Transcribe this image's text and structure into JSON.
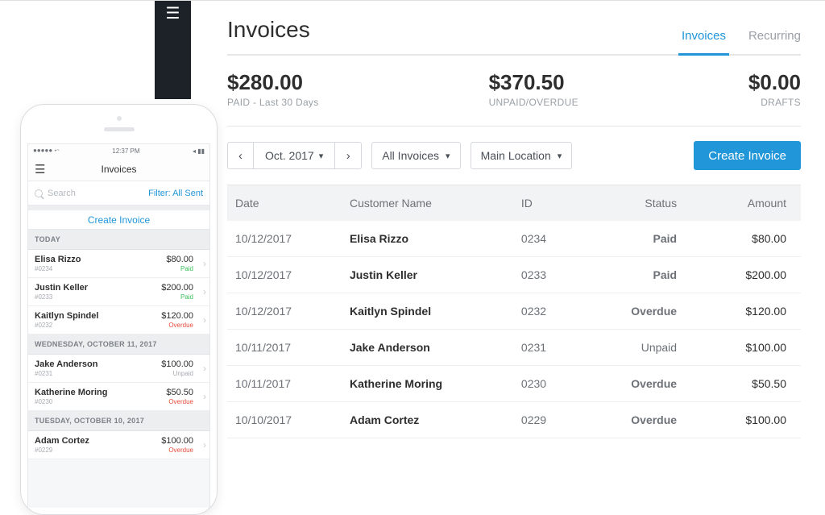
{
  "desktop": {
    "title": "Invoices",
    "tabs": {
      "invoices": "Invoices",
      "recurring": "Recurring"
    },
    "summary": {
      "paid_amount": "$280.00",
      "paid_label": "PAID - Last 30 Days",
      "unpaid_amount": "$370.50",
      "unpaid_label": "UNPAID/OVERDUE",
      "drafts_amount": "$0.00",
      "drafts_label": "DRAFTS"
    },
    "filters": {
      "date_label": "Oct. 2017",
      "scope": "All Invoices",
      "location": "Main Location"
    },
    "create_button": "Create Invoice",
    "columns": {
      "date": "Date",
      "customer": "Customer Name",
      "id": "ID",
      "status": "Status",
      "amount": "Amount"
    },
    "rows": [
      {
        "date": "10/12/2017",
        "name": "Elisa Rizzo",
        "id": "0234",
        "status": "Paid",
        "amount": "$80.00"
      },
      {
        "date": "10/12/2017",
        "name": "Justin Keller",
        "id": "0233",
        "status": "Paid",
        "amount": "$200.00"
      },
      {
        "date": "10/12/2017",
        "name": "Kaitlyn Spindel",
        "id": "0232",
        "status": "Overdue",
        "amount": "$120.00"
      },
      {
        "date": "10/11/2017",
        "name": "Jake Anderson",
        "id": "0231",
        "status": "Unpaid",
        "amount": "$100.00"
      },
      {
        "date": "10/11/2017",
        "name": "Katherine Moring",
        "id": "0230",
        "status": "Overdue",
        "amount": "$50.50"
      },
      {
        "date": "10/10/2017",
        "name": "Adam Cortez",
        "id": "0229",
        "status": "Overdue",
        "amount": "$100.00"
      }
    ]
  },
  "phone": {
    "statusbar_signal": "●●●●● ⬿",
    "statusbar_time": "12:37 PM",
    "statusbar_batt": "◂ ▮▮",
    "title": "Invoices",
    "search_placeholder": "Search",
    "filter_label": "Filter: All Sent",
    "create_label": "Create Invoice",
    "sections": [
      {
        "header": "TODAY",
        "rows": [
          {
            "name": "Elisa Rizzo",
            "id": "#0234",
            "amount": "$80.00",
            "status": "Paid",
            "status_class": "paid"
          },
          {
            "name": "Justin Keller",
            "id": "#0233",
            "amount": "$200.00",
            "status": "Paid",
            "status_class": "paid"
          },
          {
            "name": "Kaitlyn Spindel",
            "id": "#0232",
            "amount": "$120.00",
            "status": "Overdue",
            "status_class": "overdue"
          }
        ]
      },
      {
        "header": "WEDNESDAY, OCTOBER 11, 2017",
        "rows": [
          {
            "name": "Jake Anderson",
            "id": "#0231",
            "amount": "$100.00",
            "status": "Unpaid",
            "status_class": "unpaid"
          },
          {
            "name": "Katherine Moring",
            "id": "#0230",
            "amount": "$50.50",
            "status": "Overdue",
            "status_class": "overdue"
          }
        ]
      },
      {
        "header": "TUESDAY, OCTOBER 10, 2017",
        "rows": [
          {
            "name": "Adam Cortez",
            "id": "#0229",
            "amount": "$100.00",
            "status": "Overdue",
            "status_class": "overdue"
          }
        ]
      }
    ]
  }
}
